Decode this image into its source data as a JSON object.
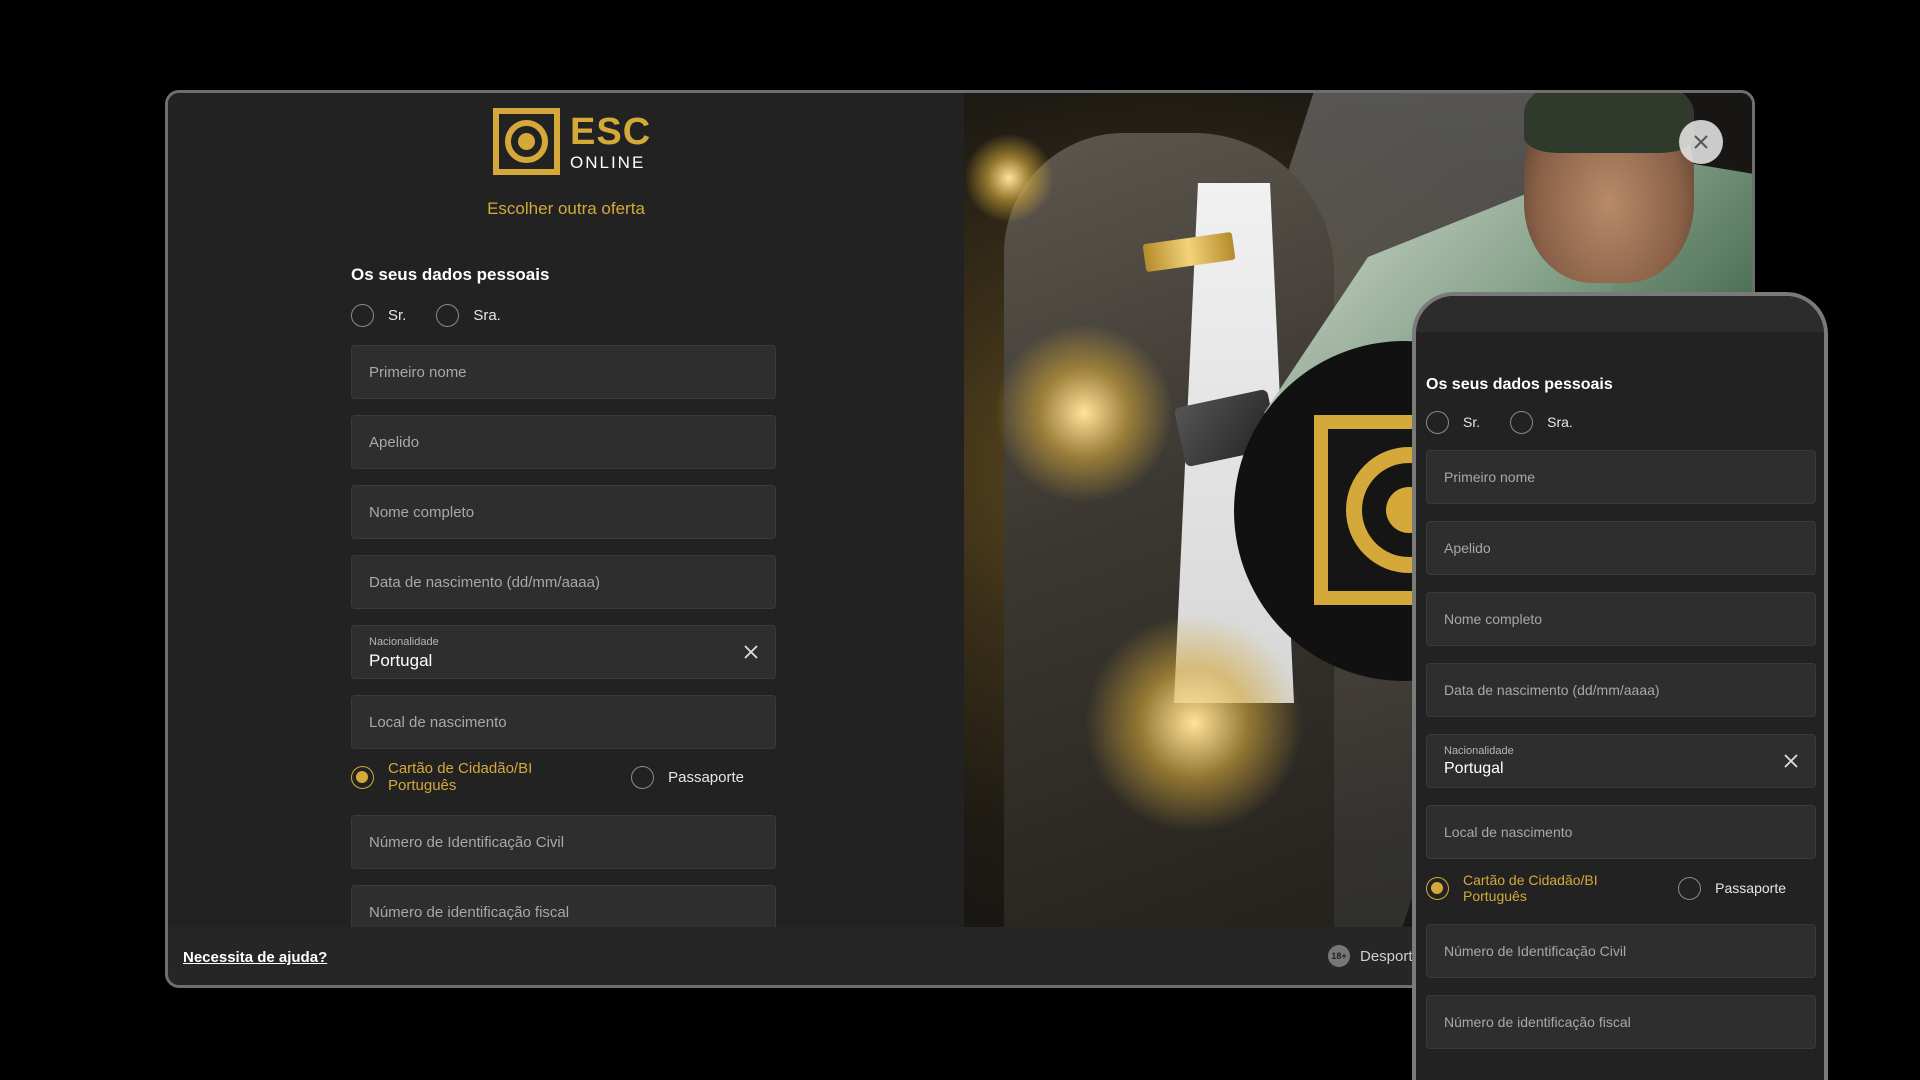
{
  "brand": {
    "name_big": "ESC",
    "name_small": "ONLINE",
    "accent_color": "#d4a93a"
  },
  "offer_link": "Escolher outra oferta",
  "form": {
    "section_title": "Os seus dados pessoais",
    "salutation": {
      "mr": "Sr.",
      "mrs": "Sra."
    },
    "fields": {
      "first_name": "Primeiro nome",
      "surname": "Apelido",
      "full_name": "Nome completo",
      "birth_date": "Data de nascimento (dd/mm/aaaa)",
      "nationality_label": "Nacionalidade",
      "nationality_value": "Portugal",
      "birth_place": "Local de nascimento",
      "civil_id": "Número de Identificação Civil",
      "tax_id": "Número de identificação fiscal"
    },
    "document_type": {
      "id_card": "Cartão de Cidadão/BI Português",
      "passport": "Passaporte",
      "selected": "id_card"
    }
  },
  "footer": {
    "help": "Necessita de ajuda?",
    "age_badge": "18+",
    "right_text": "Desporto"
  },
  "icons": {
    "close": "close-icon",
    "clear": "clear-icon"
  }
}
